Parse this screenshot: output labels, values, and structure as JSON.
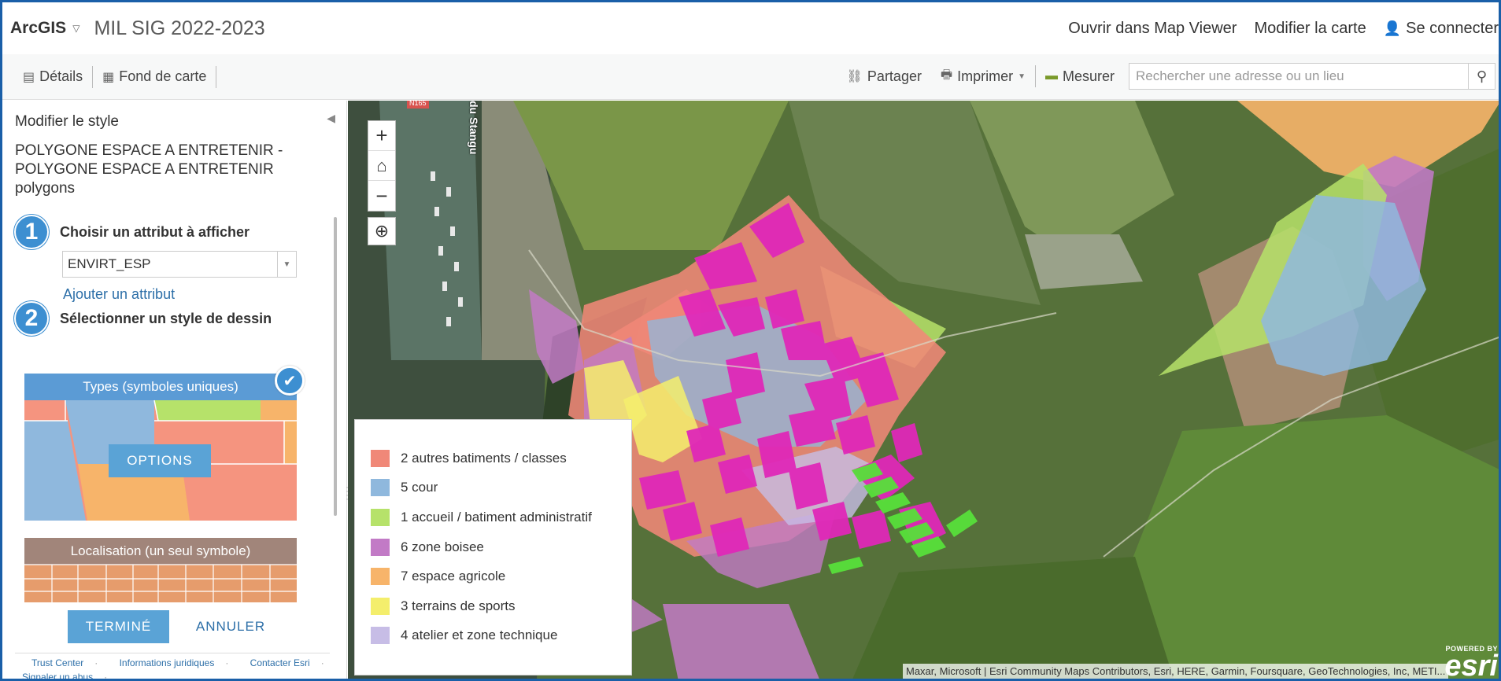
{
  "header": {
    "brand": "ArcGIS",
    "app_title": "MIL SIG 2022-2023",
    "open_map_viewer": "Ouvrir dans Map Viewer",
    "modify_map": "Modifier la carte",
    "sign_in": "Se connecter"
  },
  "toolbar": {
    "details": "Détails",
    "basemap": "Fond de carte",
    "share": "Partager",
    "print": "Imprimer",
    "measure": "Mesurer",
    "search_placeholder": "Rechercher une adresse ou un lieu"
  },
  "panel": {
    "title": "Modifier le style",
    "layer_name": "POLYGONE ESPACE A ENTRETENIR - POLYGONE ESPACE A ENTRETENIR polygons",
    "step1_number": "1",
    "step1_label": "Choisir un attribut à afficher",
    "attribute_value": "ENVIRT_ESP",
    "add_attribute": "Ajouter un attribut",
    "step2_number": "2",
    "step2_label": "Sélectionner un style de dessin",
    "style_types": "Types (symboles uniques)",
    "options_button": "OPTIONS",
    "style_location": "Localisation (un seul symbole)",
    "done_button": "TERMINÉ",
    "cancel_button": "ANNULER",
    "footer": {
      "trust": "Trust Center",
      "legal": "Informations juridiques",
      "contact": "Contacter Esri",
      "report": "Signaler un abus"
    }
  },
  "map": {
    "road_label": "du Stangu",
    "road_badge": "N165",
    "legend": [
      {
        "label": "2 autres batiments / classes",
        "color": "#f08878"
      },
      {
        "label": "5 cour",
        "color": "#8fb8dd"
      },
      {
        "label": "1 accueil / batiment administratif",
        "color": "#b6e26a"
      },
      {
        "label": "6 zone boisee",
        "color": "#c27ac6"
      },
      {
        "label": "7 espace agricole",
        "color": "#f7b46a"
      },
      {
        "label": "3 terrains de sports",
        "color": "#f4ee6c"
      },
      {
        "label": "4 atelier et zone technique",
        "color": "#c7bde6"
      }
    ],
    "attribution": "Maxar, Microsoft | Esri Community Maps Contributors, Esri, HERE, Garmin, Foursquare, GeoTechnologies, Inc, METI...",
    "esri_powered": "POWERED BY",
    "esri_logo": "esri"
  }
}
